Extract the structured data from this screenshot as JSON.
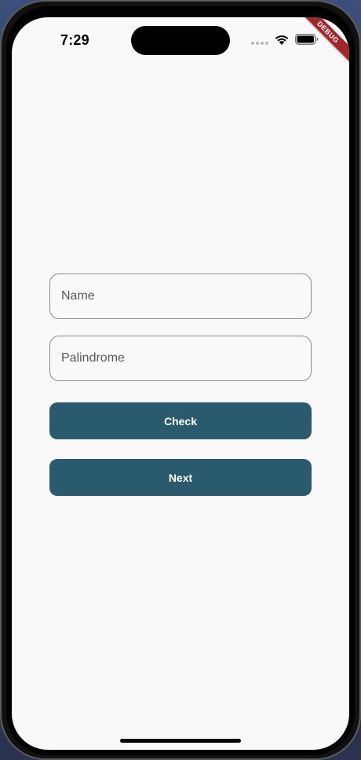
{
  "status_bar": {
    "time": "7:29",
    "signal_icon": "cellular-dots-icon",
    "wifi_icon": "wifi-icon",
    "battery_icon": "battery-icon"
  },
  "debug_banner": {
    "label": "DEBUG",
    "color": "#a3262a"
  },
  "form": {
    "name_field": {
      "placeholder": "Name",
      "value": ""
    },
    "palindrome_field": {
      "placeholder": "Palindrome",
      "value": ""
    },
    "check_button_label": "Check",
    "next_button_label": "Next"
  },
  "theme": {
    "background": "#f9f9f9",
    "button_color": "#295a6e",
    "button_text_color": "#ffffff",
    "field_border_color": "#8c8c8c"
  }
}
